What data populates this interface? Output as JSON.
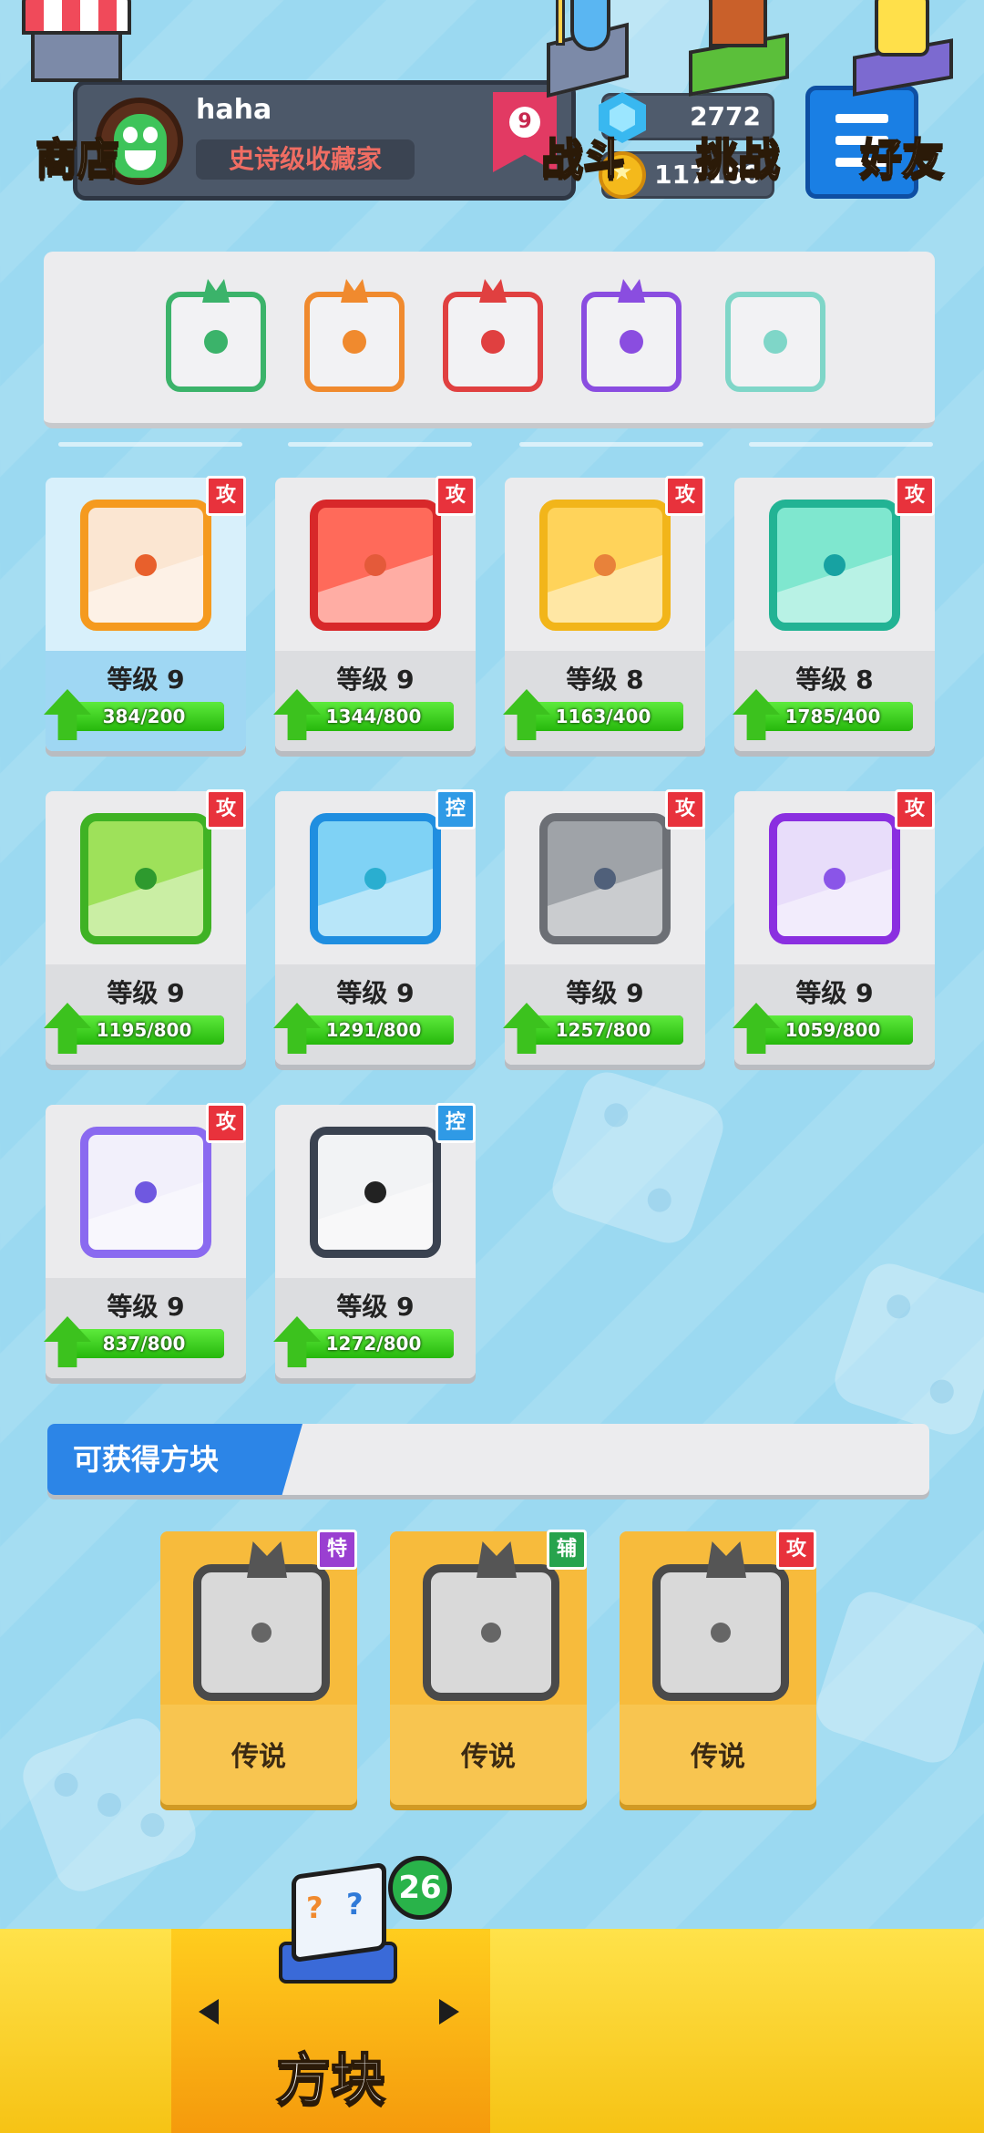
{
  "profile": {
    "name": "haha",
    "title": "史诗级收藏家",
    "rank": "9"
  },
  "currency": {
    "gems": "2772",
    "coins": "117160"
  },
  "colors": {
    "attack_tag": "#e8323c",
    "control_tag": "#2f9ae6",
    "special_tag": "#9a3fd1",
    "support_tag": "#27a34d"
  },
  "equipped_blocks": [
    {
      "icon": "wind-swirl-icon",
      "color": "#3bb36a"
    },
    {
      "icon": "infinity-icon",
      "color": "#f08a2e"
    },
    {
      "icon": "saw-blade-icon",
      "color": "#e04040"
    },
    {
      "icon": "purple-orb-icon",
      "color": "#8a4de0"
    },
    {
      "icon": "healing-hands-icon",
      "color": "#7fd6c8"
    }
  ],
  "blocks": [
    {
      "icon": "bow-arrow-icon",
      "tag": "攻",
      "tag_type": "attack",
      "level": "等级 9",
      "progress": "384/200",
      "fill": 1.0,
      "border": "#f59a1f",
      "bg": "#fbe6d2",
      "dot": "#e8602c",
      "selected": true
    },
    {
      "icon": "fire-icon",
      "tag": "攻",
      "tag_type": "attack",
      "level": "等级 9",
      "progress": "1344/800",
      "fill": 1.0,
      "border": "#d8282a",
      "bg": "#ff6a5a",
      "dot": "#e45a3a"
    },
    {
      "icon": "lightning-icon",
      "tag": "攻",
      "tag_type": "attack",
      "level": "等级 8",
      "progress": "1163/400",
      "fill": 1.0,
      "border": "#f2b51a",
      "bg": "#ffd35a",
      "dot": "#e8823a"
    },
    {
      "icon": "wind-icon",
      "tag": "攻",
      "tag_type": "attack",
      "level": "等级 8",
      "progress": "1785/400",
      "fill": 1.0,
      "border": "#22b394",
      "bg": "#7fe7cf",
      "dot": "#17a2a2"
    },
    {
      "icon": "poison-icon",
      "tag": "攻",
      "tag_type": "attack",
      "level": "等级 9",
      "progress": "1195/800",
      "fill": 1.0,
      "border": "#3fb224",
      "bg": "#9ee15a",
      "dot": "#2e9a2e"
    },
    {
      "icon": "ice-icon",
      "tag": "控",
      "tag_type": "control",
      "level": "等级 9",
      "progress": "1291/800",
      "fill": 1.0,
      "border": "#1f8ee0",
      "bg": "#7fd2f5",
      "dot": "#2aaed0"
    },
    {
      "icon": "gear-icon",
      "tag": "攻",
      "tag_type": "attack",
      "level": "等级 9",
      "progress": "1257/800",
      "fill": 1.0,
      "border": "#6c6f75",
      "bg": "#9fa3a8",
      "dot": "#50607a"
    },
    {
      "icon": "swap-arrows-icon",
      "tag": "攻",
      "tag_type": "attack",
      "level": "等级 9",
      "progress": "1059/800",
      "fill": 1.0,
      "border": "#8a2fe0",
      "bg": "#e8ddfa",
      "dot": "#8a55e8"
    },
    {
      "icon": "mystery-icon",
      "tag": "攻",
      "tag_type": "attack",
      "level": "等级 9",
      "progress": "837/800",
      "fill": 1.0,
      "border": "#8a6af0",
      "bg": "#f2f0fb",
      "dot": "#6f58e0"
    },
    {
      "icon": "lock-icon",
      "tag": "控",
      "tag_type": "control",
      "level": "等级 9",
      "progress": "1272/800",
      "fill": 1.0,
      "border": "#3a4250",
      "bg": "#f2f3f5",
      "dot": "#222"
    }
  ],
  "available": {
    "title": "可获得方块",
    "items": [
      {
        "icon": "dark-flame-icon",
        "tag": "特",
        "tag_type": "special",
        "label": "传说"
      },
      {
        "icon": "moon-icon",
        "tag": "辅",
        "tag_type": "support",
        "label": "传说"
      },
      {
        "icon": "star-icon",
        "tag": "攻",
        "tag_type": "attack",
        "label": "传说"
      }
    ]
  },
  "nav": {
    "shop": "商店",
    "blocks": "方块",
    "blocks_badge": "26",
    "battle": "战斗",
    "challenge": "挑战",
    "friends": "好友"
  }
}
